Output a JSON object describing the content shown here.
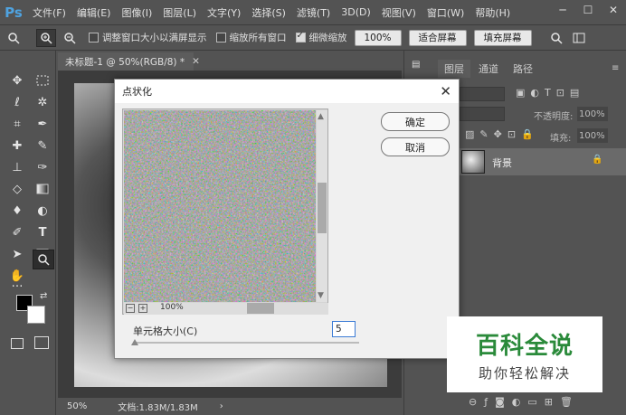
{
  "menubar": {
    "logo": "Ps",
    "items": [
      "文件(F)",
      "编辑(E)",
      "图像(I)",
      "图层(L)",
      "文字(Y)",
      "选择(S)",
      "滤镜(T)",
      "3D(D)",
      "视图(V)",
      "窗口(W)",
      "帮助(H)"
    ],
    "minimize": "─",
    "maximize": "☐",
    "close": "✕"
  },
  "options": {
    "resize_window_label": "调整窗口大小以满屏显示",
    "zoom_all_label": "缩放所有窗口",
    "scrubby_zoom_label": "细微缩放",
    "zoom_100_button": "100%",
    "fit_screen_button": "适合屏幕",
    "fill_screen_button": "填充屏幕",
    "resize_window_checked": false,
    "zoom_all_checked": false,
    "scrubby_zoom_checked": true
  },
  "document": {
    "tab_title": "未标题-1 @ 50%(RGB/8) *",
    "zoom": "50%",
    "doc_size": "文档:1.83M/1.83M"
  },
  "panels": {
    "layers_tab": "图层",
    "channels_tab": "通道",
    "paths_tab": "路径",
    "opacity_label": "不透明度:",
    "opacity_value": "100%",
    "fill_label": "填充:",
    "fill_value": "100%",
    "layer_name": "背景"
  },
  "dialog": {
    "title": "点状化",
    "ok_button": "确定",
    "cancel_button": "取消",
    "preview_zoom": "100%",
    "cell_size_label": "单元格大小(C)",
    "cell_size_value": "5"
  },
  "watermark": {
    "title": "百科全说",
    "subtitle": "助你轻松解决"
  }
}
